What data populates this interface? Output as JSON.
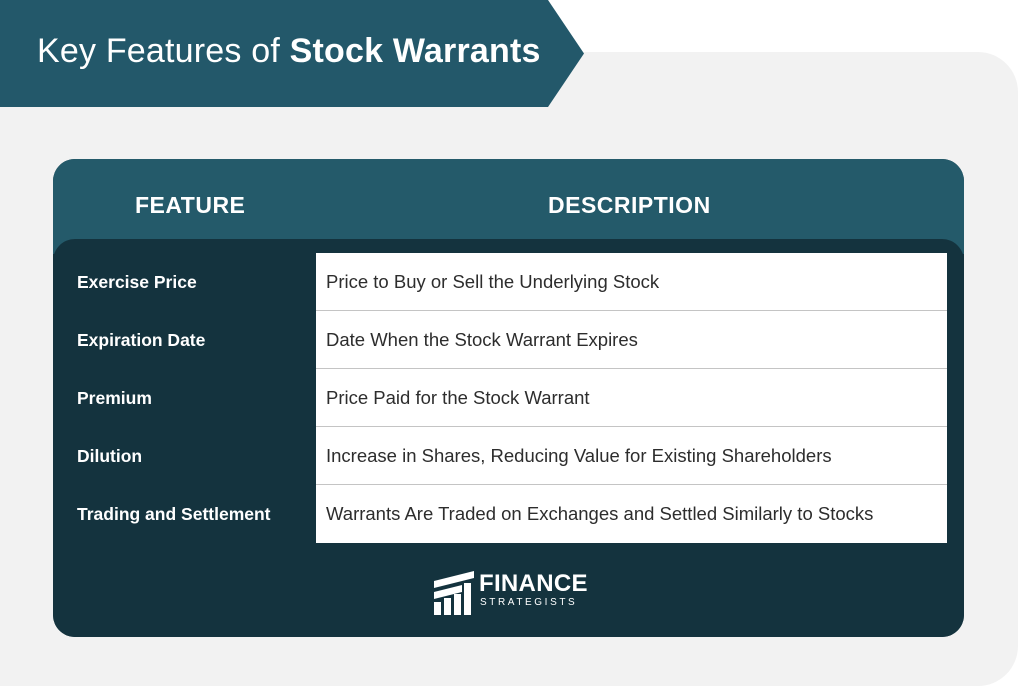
{
  "title": {
    "prefix": "Key Features of ",
    "emphasis": "Stock Warrants"
  },
  "table": {
    "headers": {
      "feature": "FEATURE",
      "description": "DESCRIPTION"
    },
    "rows": [
      {
        "feature": "Exercise Price",
        "description": "Price to Buy or Sell the Underlying Stock"
      },
      {
        "feature": "Expiration Date",
        "description": "Date When the Stock Warrant Expires"
      },
      {
        "feature": "Premium",
        "description": "Price Paid for the Stock Warrant"
      },
      {
        "feature": "Dilution",
        "description": "Increase in Shares, Reducing Value for Existing Shareholders"
      },
      {
        "feature": "Trading and Settlement",
        "description": "Warrants Are Traded on Exchanges and Settled Similarly to Stocks"
      }
    ]
  },
  "logo": {
    "line1": "FINANCE",
    "line2": "STRATEGISTS",
    "icon": "finance-strategists-logo-icon"
  },
  "colors": {
    "banner": "#23586a",
    "header": "#245a6a",
    "card_body": "#14333e",
    "background": "#f2f2f2"
  }
}
